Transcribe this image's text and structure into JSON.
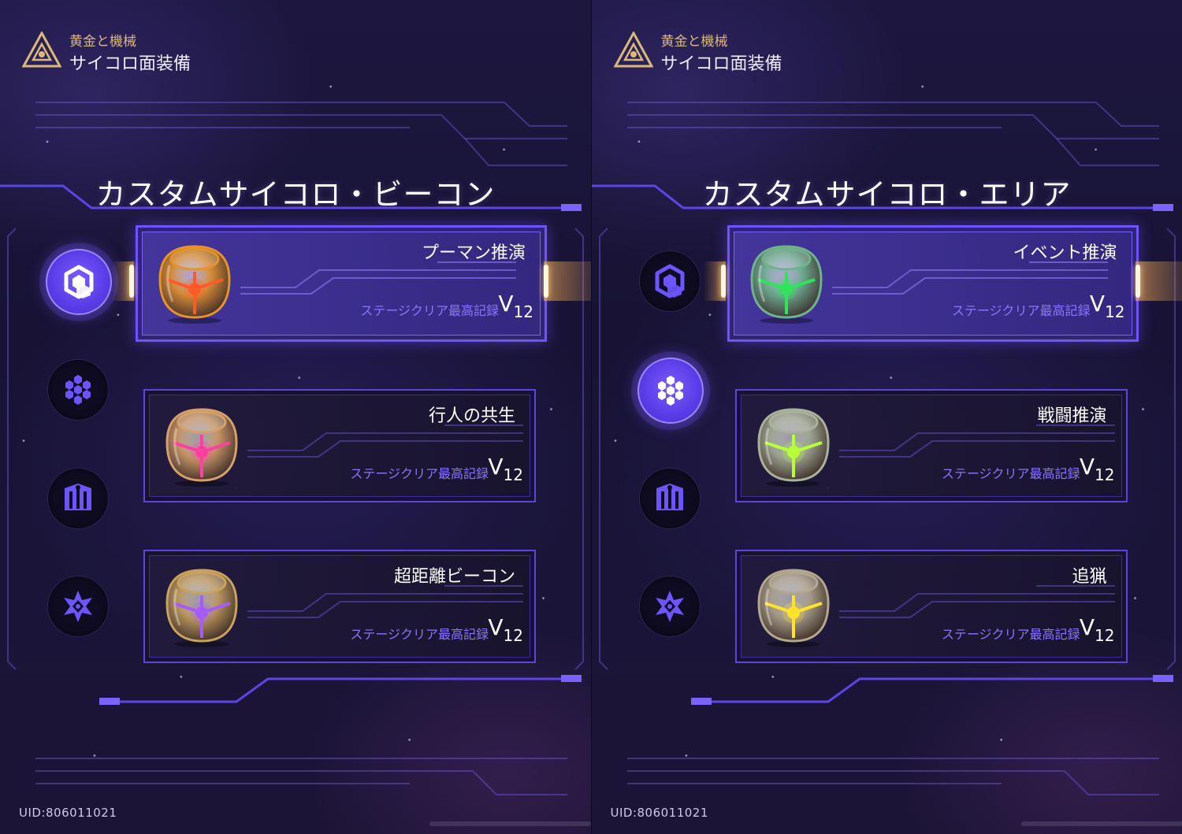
{
  "panels": [
    {
      "header": {
        "subtitle": "黄金と機械",
        "title": "サイコロ面装備"
      },
      "section_title": "カスタムサイコロ・ビーコン",
      "active_side_index": 0,
      "side_icons": [
        "dice-face-icon",
        "flower-cluster-icon",
        "pillar-icon",
        "star-shield-icon"
      ],
      "cards": [
        {
          "name": "プーマン推演",
          "record_label": "ステージクリア最高記録",
          "record_letter": "V",
          "record_sub": "12",
          "dice_color": "#e5932a",
          "dice_glow": "#ff5a28",
          "active": true
        },
        {
          "name": "行人の共生",
          "record_label": "ステージクリア最高記録",
          "record_letter": "V",
          "record_sub": "12",
          "dice_color": "#d6a06b",
          "dice_glow": "#ff3fa2",
          "active": false
        },
        {
          "name": "超距離ビーコン",
          "record_label": "ステージクリア最高記録",
          "record_letter": "V",
          "record_sub": "12",
          "dice_color": "#c9a260",
          "dice_glow": "#a45cff",
          "active": false
        }
      ],
      "uid": "UID:806011021"
    },
    {
      "header": {
        "subtitle": "黄金と機械",
        "title": "サイコロ面装備"
      },
      "section_title": "カスタムサイコロ・エリア",
      "active_side_index": 1,
      "side_icons": [
        "dice-face-icon",
        "flower-cluster-icon",
        "pillar-icon",
        "star-shield-icon"
      ],
      "cards": [
        {
          "name": "イベント推演",
          "record_label": "ステージクリア最高記録",
          "record_letter": "V",
          "record_sub": "12",
          "dice_color": "#6fb38c",
          "dice_glow": "#2fe35a",
          "active": true
        },
        {
          "name": "戦闘推演",
          "record_label": "ステージクリア最高記録",
          "record_letter": "V",
          "record_sub": "12",
          "dice_color": "#a9b29a",
          "dice_glow": "#b6ff3a",
          "active": false
        },
        {
          "name": "追猟",
          "record_label": "ステージクリア最高記録",
          "record_letter": "V",
          "record_sub": "12",
          "dice_color": "#b2a88f",
          "dice_glow": "#ffe22a",
          "active": false
        }
      ],
      "uid": "UID:806011021"
    }
  ],
  "colors": {
    "accent": "#6e54ff",
    "label": "#8a76ff",
    "gold": "#d9b97a"
  }
}
